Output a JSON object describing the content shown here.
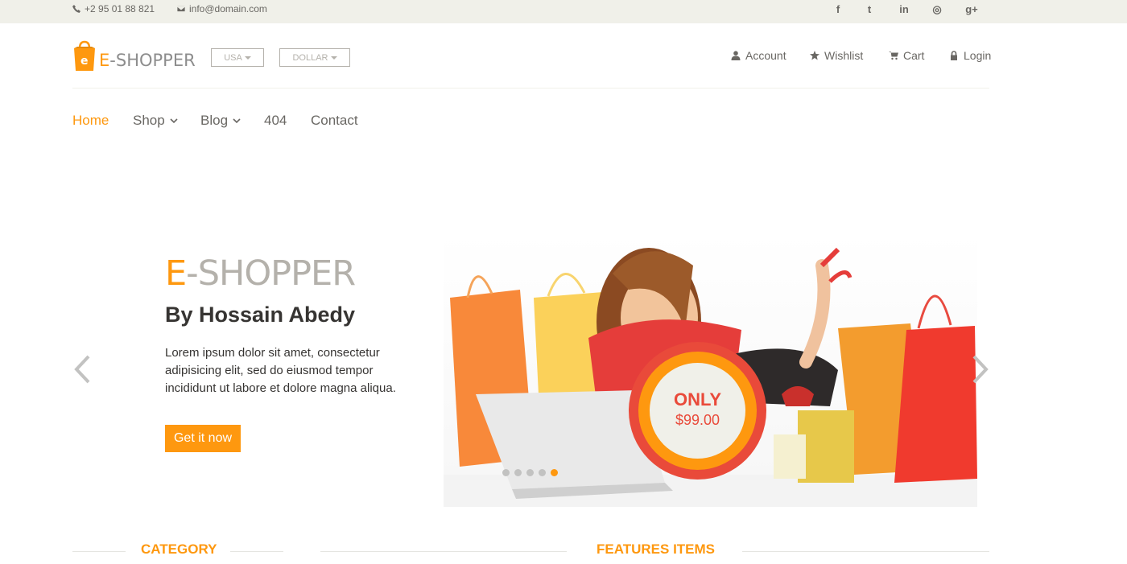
{
  "topbar": {
    "phone": "+2 95 01 88 821",
    "email": "info@domain.com",
    "social": [
      {
        "icon": "facebook-icon",
        "glyph": "f"
      },
      {
        "icon": "twitter-icon",
        "glyph": "t"
      },
      {
        "icon": "linkedin-icon",
        "glyph": "in"
      },
      {
        "icon": "dribbble-icon",
        "glyph": "◎"
      },
      {
        "icon": "google-plus-icon",
        "glyph": "g+"
      }
    ]
  },
  "header": {
    "logo_e": "E",
    "logo_rest": "-SHOPPER",
    "country": "USA",
    "currency": "DOLLAR",
    "links": {
      "account": "Account",
      "wishlist": "Wishlist",
      "cart": "Cart",
      "login": "Login"
    }
  },
  "nav": {
    "home": "Home",
    "shop": "Shop",
    "blog": "Blog",
    "not_found": "404",
    "contact": "Contact"
  },
  "slider": {
    "title_e": "E",
    "title_rest": "-SHOPPER",
    "subtitle": "By Hossain Abedy",
    "text": "Lorem ipsum dolor sit amet, consectetur adipisicing elit, sed do eiusmod tempor incididunt ut labore et dolore magna aliqua.",
    "button": "Get it now",
    "badge_label": "ONLY",
    "badge_price": "$99.00",
    "active_slide": 5,
    "slide_count": 5
  },
  "sections": {
    "category": "CATEGORY",
    "features": "FEATURES ITEMS"
  },
  "colors": {
    "accent": "#fe980f",
    "badge_red": "#e94a3a",
    "topbar_bg": "#f0f0e9"
  }
}
